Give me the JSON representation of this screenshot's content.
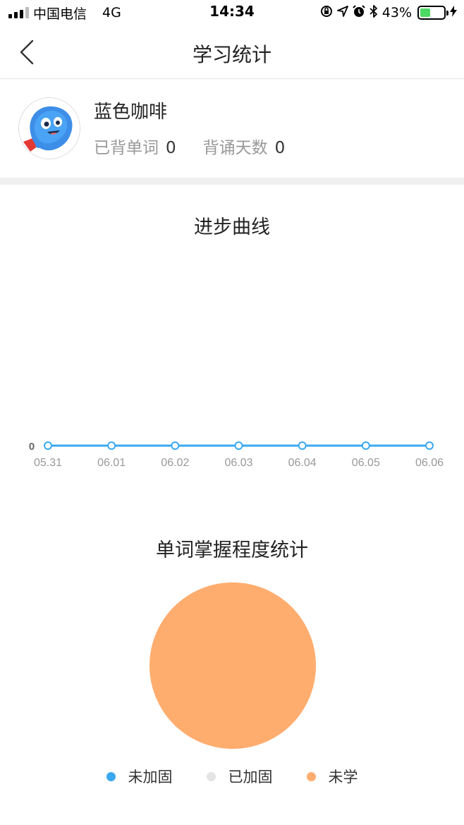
{
  "status_bar": {
    "carrier": "中国电信",
    "network": "4G",
    "time": "14:34",
    "battery": "43%",
    "battery_level": 0.43,
    "icons": [
      "signal-icon",
      "rotation-lock-icon",
      "location-icon",
      "alarm-icon",
      "bluetooth-icon",
      "battery-icon",
      "charging-icon"
    ]
  },
  "nav": {
    "title": "学习统计",
    "back_icon": "back-chevron-icon"
  },
  "profile": {
    "name": "蓝色咖啡",
    "words_label": "已背单词",
    "words_value": "0",
    "days_label": "背诵天数",
    "days_value": "0"
  },
  "progress_section": {
    "title": "进步曲线"
  },
  "mastery_section": {
    "title": "单词掌握程度统计"
  },
  "colors": {
    "accent_blue": "#3aa8f0",
    "consolidated_gray": "#e4e4e4",
    "unlearned_orange": "#ffad6f"
  },
  "chart_data": [
    {
      "type": "line",
      "title": "进步曲线",
      "x": [
        "05.31",
        "06.01",
        "06.02",
        "06.03",
        "06.04",
        "06.05",
        "06.06"
      ],
      "series": [
        {
          "values": [
            0,
            0,
            0,
            0,
            0,
            0,
            0
          ]
        }
      ],
      "y_tick_labels": [
        "0"
      ],
      "grid": false
    },
    {
      "type": "pie",
      "title": "单词掌握程度统计",
      "categories": [
        "未加固",
        "已加固",
        "未学"
      ],
      "values": [
        0,
        0,
        1
      ],
      "colors": [
        "#3aa8f0",
        "#e4e4e4",
        "#ffad6f"
      ],
      "legend_position": "bottom"
    }
  ]
}
